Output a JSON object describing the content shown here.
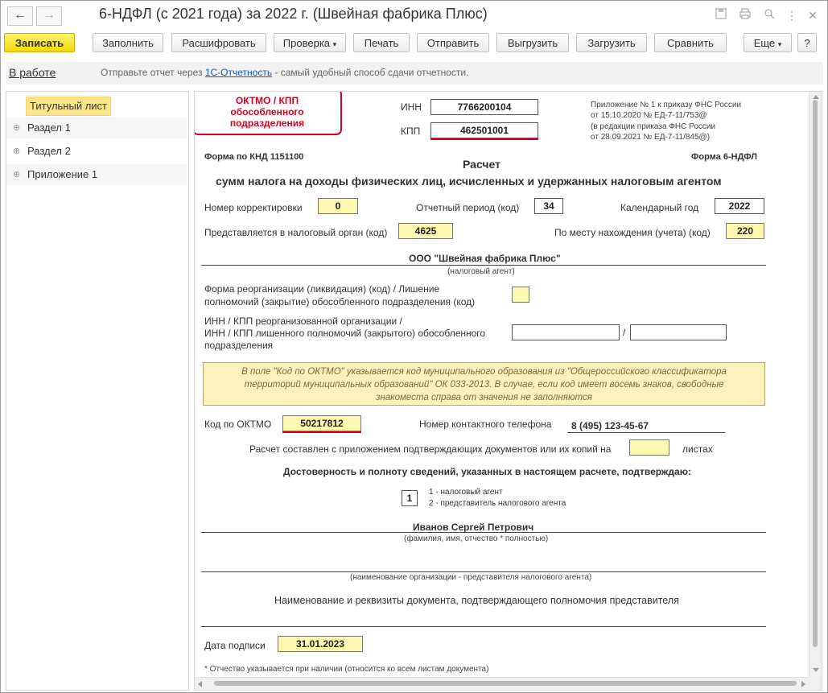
{
  "window": {
    "title": "6-НДФЛ (с 2021 года) за 2022 г. (Швейная фабрика Плюс)",
    "nav_back": "←",
    "nav_forward": "→"
  },
  "toolbar": {
    "save": "Записать",
    "fill": "Заполнить",
    "decode": "Расшифровать",
    "check": "Проверка",
    "print": "Печать",
    "send": "Отправить",
    "export": "Выгрузить",
    "import": "Загрузить",
    "compare": "Сравнить",
    "more": "Еще",
    "help": "?"
  },
  "info": {
    "status": "В работе",
    "msg_before": "Отправьте отчет через ",
    "link": "1С-Отчетность",
    "msg_after": " - самый удобный способ сдачи отчетности."
  },
  "tree": [
    {
      "label": "Титульный лист",
      "selected": true
    },
    {
      "label": "Раздел 1"
    },
    {
      "label": "Раздел 2"
    },
    {
      "label": "Приложение 1"
    }
  ],
  "form": {
    "callout": "ОКТМО / КПП обособленного подразделения",
    "inn_label": "ИНН",
    "inn": "7766200104",
    "kpp_label": "КПП",
    "kpp": "462501001",
    "order_line1": "Приложение № 1 к приказу ФНС России",
    "order_line2": "от 15.10.2020 № ЕД-7-11/753@",
    "order_line3": "(в редакции приказа ФНС России",
    "order_line4": "от 28.09.2021 № ЕД-7-11/845@)",
    "knd": "Форма по КНД 1151100",
    "form_name": "Форма 6-НДФЛ",
    "heading1": "Расчет",
    "heading2": "сумм налога на доходы физических лиц, исчисленных и удержанных налоговым агентом",
    "corr_label": "Номер корректировки",
    "corr": "0",
    "period_label": "Отчетный период (код)",
    "period": "34",
    "year_label": "Календарный год",
    "year": "2022",
    "authority_label": "Представляется в налоговый орган (код)",
    "authority": "4625",
    "place_label": "По месту нахождения (учета) (код)",
    "place": "220",
    "agent_name": "ООО \"Швейная фабрика Плюс\"",
    "agent_caption": "(налоговый агент)",
    "reorg_label1": "Форма реорганизации (ликвидация) (код) / Лишение",
    "reorg_label2": "полномочий (закрытие) обособленного подразделения (код)",
    "reorg_inn_label1": "ИНН / КПП реорганизованной организации /",
    "reorg_inn_label2": "ИНН / КПП лишенного полномочий (закрытого) обособленного",
    "reorg_inn_label3": "подразделения",
    "slash": "/",
    "hint1": "В поле \"Код по ОКТМО\" указывается код муниципального образования из \"Общероссийского классификатора",
    "hint2": "территорий муниципальных образований\" ОК 033-2013. В случае, если код имеет восемь знаков, свободные",
    "hint3": "знакоместа справа от значения не заполняются",
    "oktmo_label": "Код по ОКТМО",
    "oktmo": "50217812",
    "phone_label": "Номер контактного телефона",
    "phone": "8 (495) 123-45-67",
    "pages_label": "Расчет составлен с приложением подтверждающих документов или их копий на",
    "pages_suffix": "листах",
    "confirm": "Достоверность и полноту сведений, указанных в настоящем расчете, подтверждаю:",
    "signer_code": "1",
    "signer_opt1": "1 - налоговый агент",
    "signer_opt2": "2 - представитель налогового агента",
    "signer_name": "Иванов Сергей Петрович",
    "signer_caption": "(фамилия, имя, отчество * полностью)",
    "org_caption": "(наименование организации - представителя налогового агента)",
    "doc_label": "Наименование и реквизиты документа, подтверждающего полномочия представителя",
    "date_label": "Дата подписи",
    "date": "31.01.2023",
    "footnote": "* Отчество указывается при наличии (относится ко всем листам документа)"
  }
}
